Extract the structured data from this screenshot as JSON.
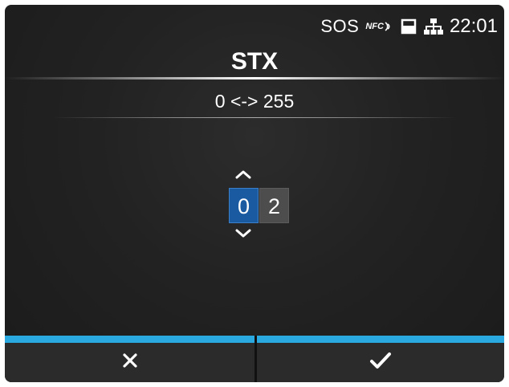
{
  "status_bar": {
    "sos_label": "SOS",
    "nfc_label": "NFC",
    "time": "22:01",
    "icons": [
      "nfc-icon",
      "memory-card-icon",
      "network-icon"
    ]
  },
  "header": {
    "title": "STX",
    "range": "0 <-> 255"
  },
  "editor": {
    "digits": [
      "0",
      "2"
    ],
    "selected_digit_index": 0,
    "value": "02",
    "up_icon": "chevron-up-icon",
    "down_icon": "chevron-down-icon"
  },
  "softkeys": {
    "cancel_icon": "close-icon",
    "confirm_icon": "checkmark-icon",
    "accent_color": "#2aa8e0"
  },
  "colors": {
    "selected_digit_bg": "#1a5aa0",
    "unselected_digit_bg": "#4d4d4d",
    "screen_bg": "#222222"
  }
}
